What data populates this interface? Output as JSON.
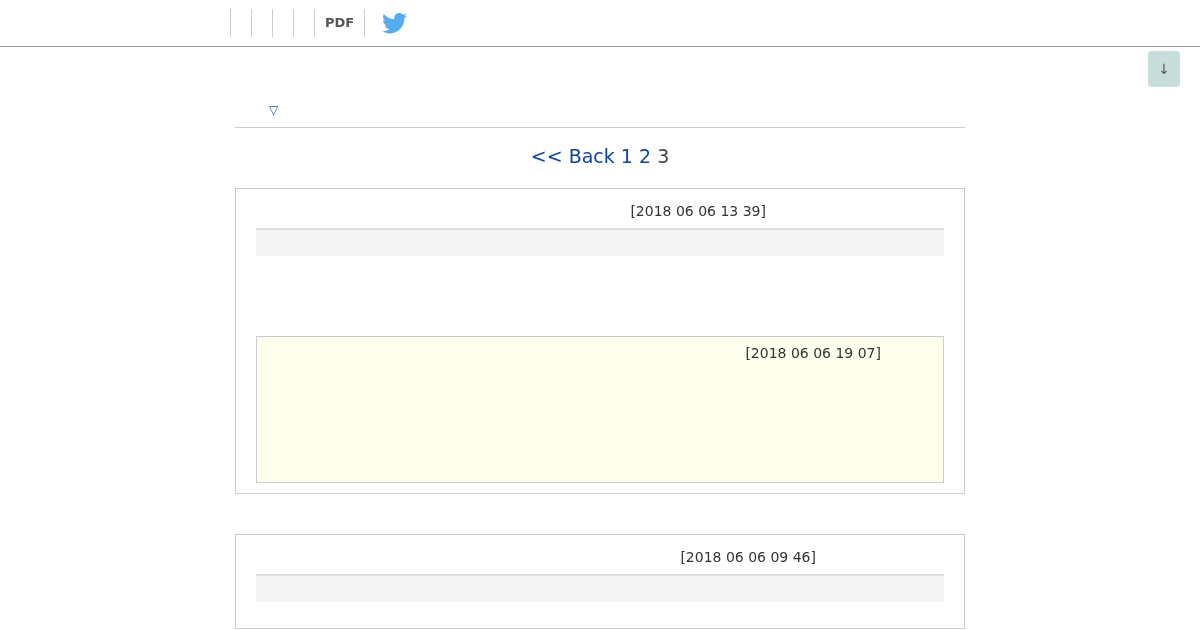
{
  "toolbar": {
    "pdf_label": "PDF"
  },
  "scroll_button": {
    "label": "↓"
  },
  "toggle": {
    "label": "▽"
  },
  "pagination": [
    {
      "label": "<< Back",
      "selected": false
    },
    {
      "label": "1",
      "selected": false
    },
    {
      "label": "2",
      "selected": false
    },
    {
      "label": "3",
      "selected": true
    }
  ],
  "posts": [
    {
      "date": "[2018 06 06 13 39]",
      "replies": [
        {
          "date": "[2018 06 06 19 07]"
        }
      ]
    },
    {
      "date": "[2018 06 06 09 46]"
    }
  ]
}
